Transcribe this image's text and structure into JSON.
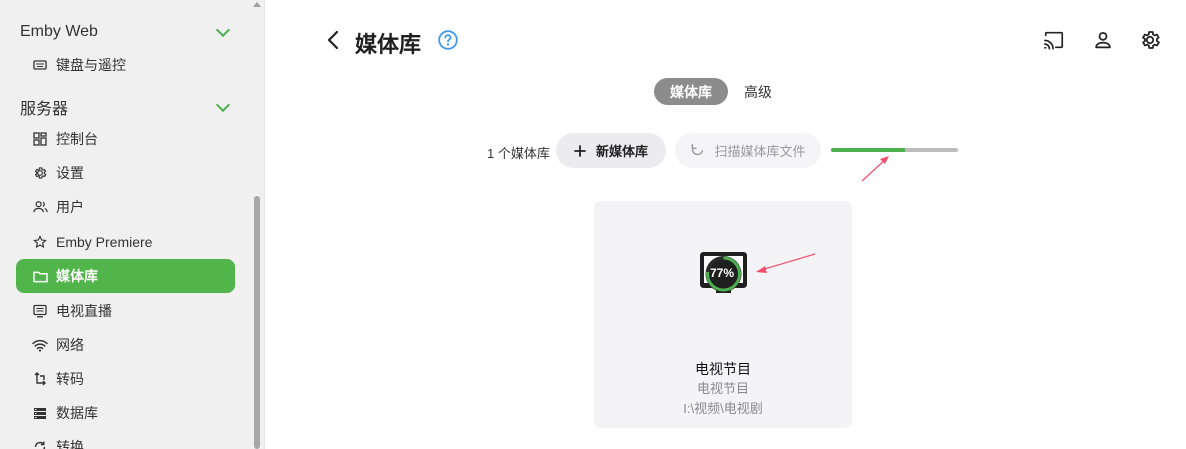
{
  "sidebar": {
    "section_emby_web": {
      "label": "Emby Web"
    },
    "item_keyboard": {
      "label": "键盘与遥控",
      "icon": "keyboard-icon"
    },
    "section_server": {
      "label": "服务器"
    },
    "items": [
      {
        "label": "控制台",
        "icon": "dashboard-icon"
      },
      {
        "label": "设置",
        "icon": "gear-icon"
      },
      {
        "label": "用户",
        "icon": "users-icon"
      },
      {
        "label": "Emby Premiere",
        "icon": "star-icon"
      },
      {
        "label": "媒体库",
        "icon": "folder-icon",
        "active": true
      },
      {
        "label": "电视直播",
        "icon": "tv-guide-icon"
      },
      {
        "label": "网络",
        "icon": "wifi-icon"
      },
      {
        "label": "转码",
        "icon": "transcode-icon"
      },
      {
        "label": "数据库",
        "icon": "database-icon"
      },
      {
        "label": "转换",
        "icon": "convert-icon"
      }
    ]
  },
  "header": {
    "title": "媒体库"
  },
  "tabs": [
    {
      "label": "媒体库",
      "active": true
    },
    {
      "label": "高级",
      "active": false
    }
  ],
  "toolbar": {
    "count_label": "1 个媒体库",
    "new_library_label": "新媒体库",
    "scan_label": "扫描媒体库文件",
    "scan_progress": 0.58
  },
  "library_card": {
    "name": "电视节目",
    "type": "电视节目",
    "path": "I:\\视频\\电视剧",
    "progress_label": "77%"
  },
  "colors": {
    "accent": "#52b54b",
    "progress_track": "#bdbdbd",
    "annotation_arrow": "#f0506e",
    "help_icon": "#3d9be9"
  }
}
